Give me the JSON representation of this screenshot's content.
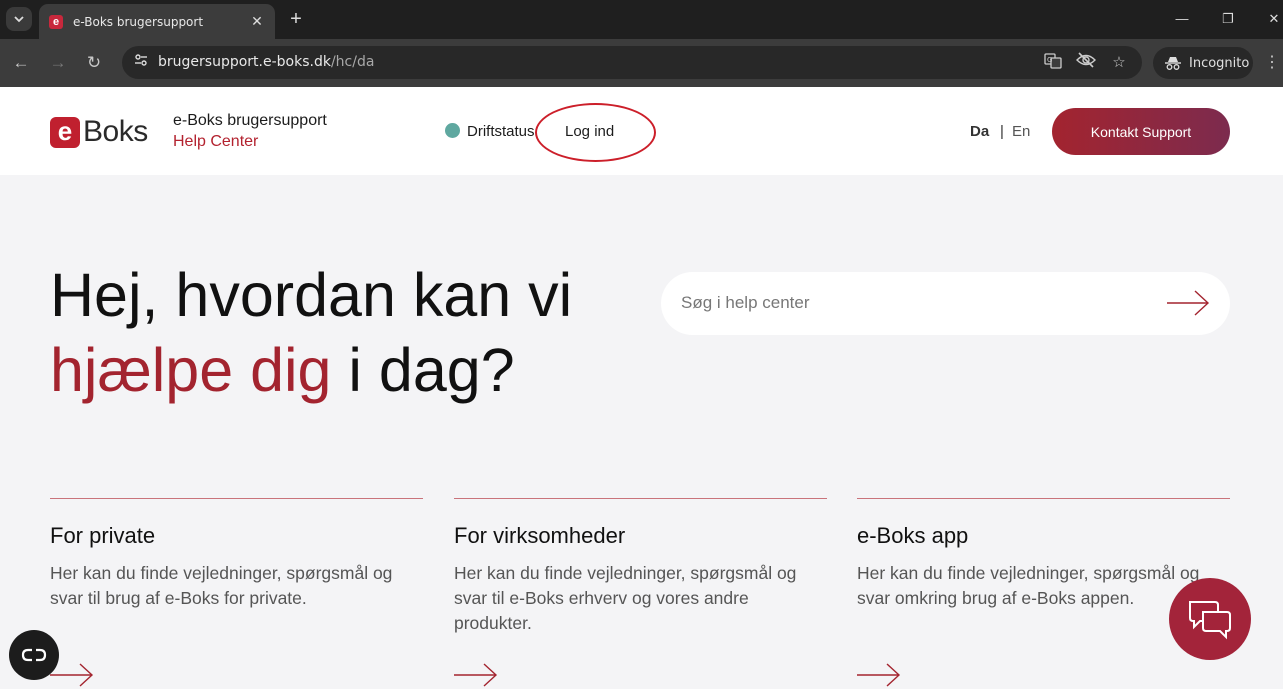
{
  "browser": {
    "tab_title": "e-Boks brugersupport",
    "favicon_letter": "e",
    "url_host": "brugersupport.e-boks.dk",
    "url_path": "/hc/da",
    "incognito_label": "Incognito"
  },
  "header": {
    "logo_letter": "e",
    "logo_word": "Boks",
    "brand_name": "e-Boks brugersupport",
    "brand_sub": "Help Center",
    "status_label": "Driftstatus",
    "login_label": "Log ind",
    "lang_da": "Da",
    "lang_sep": "|",
    "lang_en": "En",
    "contact_label": "Kontakt Support"
  },
  "hero": {
    "line1": "Hej, hvordan kan vi",
    "line2_accent": "hjælpe dig",
    "line2_rest": " i dag?",
    "search_placeholder": "Søg i help center"
  },
  "cards": [
    {
      "title": "For private",
      "desc": "Her kan du finde vejledninger, spørgsmål og svar til brug af e-Boks for private."
    },
    {
      "title": "For virksomheder",
      "desc": "Her kan du finde vejledninger, spørgsmål og svar til e-Boks erhverv og vores andre produkter."
    },
    {
      "title": "e-Boks app",
      "desc": "Her kan du finde vejledninger, spørgsmål og svar omkring brug af e-Boks appen."
    }
  ],
  "colors": {
    "brand_red": "#a3242f",
    "status_green": "#5fa8a0",
    "annotation_red": "#cc1f2a"
  }
}
